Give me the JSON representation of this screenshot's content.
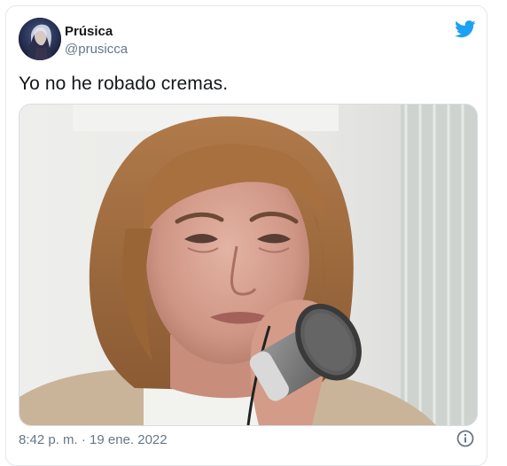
{
  "tweet": {
    "author_name": "Prúsica",
    "author_handle": "@prusicca",
    "text": "Yo no he robado cremas.",
    "timestamp": "8:42 p. m. · 19 ene. 2022"
  },
  "colors": {
    "brand": "#1da1f2",
    "text_primary": "#14171a",
    "text_secondary": "#657786",
    "border": "#e1e8ed"
  },
  "icons": {
    "logo": "twitter-bird-icon",
    "info": "info-icon"
  }
}
